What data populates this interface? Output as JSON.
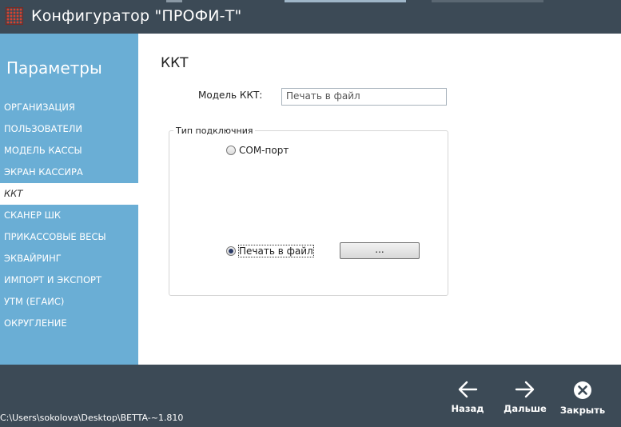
{
  "window": {
    "title": "Конфигуратор \"ПРОФИ-Т\""
  },
  "sidebar": {
    "title": "Параметры",
    "items": [
      {
        "label": "ОРГАНИЗАЦИЯ",
        "active": false
      },
      {
        "label": "ПОЛЬЗОВАТЕЛИ",
        "active": false
      },
      {
        "label": "МОДЕЛЬ КАССЫ",
        "active": false
      },
      {
        "label": "ЭКРАН КАССИРА",
        "active": false
      },
      {
        "label": "ККТ",
        "active": true
      },
      {
        "label": "СКАНЕР ШК",
        "active": false
      },
      {
        "label": "ПРИКАССОВЫЕ ВЕСЫ",
        "active": false
      },
      {
        "label": "ЭКВАЙРИНГ",
        "active": false
      },
      {
        "label": "ИМПОРТ И ЭКСПОРТ",
        "active": false
      },
      {
        "label": "УТМ (ЕГАИС)",
        "active": false
      },
      {
        "label": "ОКРУГЛЕНИЕ",
        "active": false
      }
    ]
  },
  "main": {
    "heading": "ККТ",
    "model_label": "Модель ККТ:",
    "model_value": "Печать в файл",
    "connection": {
      "legend": "Тип подключния",
      "options": [
        {
          "label": "COM-порт",
          "selected": false
        },
        {
          "label": "Печать в файл",
          "selected": true
        }
      ],
      "browse_label": "..."
    }
  },
  "footer": {
    "path": "C:\\Users\\sokolova\\Desktop\\BETTA-~1.810",
    "back_label": "Назад",
    "next_label": "Дальше",
    "close_label": "Закрыть"
  },
  "icons": {
    "back": "arrow-left-icon",
    "next": "arrow-right-icon",
    "close": "close-circle-icon",
    "logo": "app-logo-icon"
  }
}
